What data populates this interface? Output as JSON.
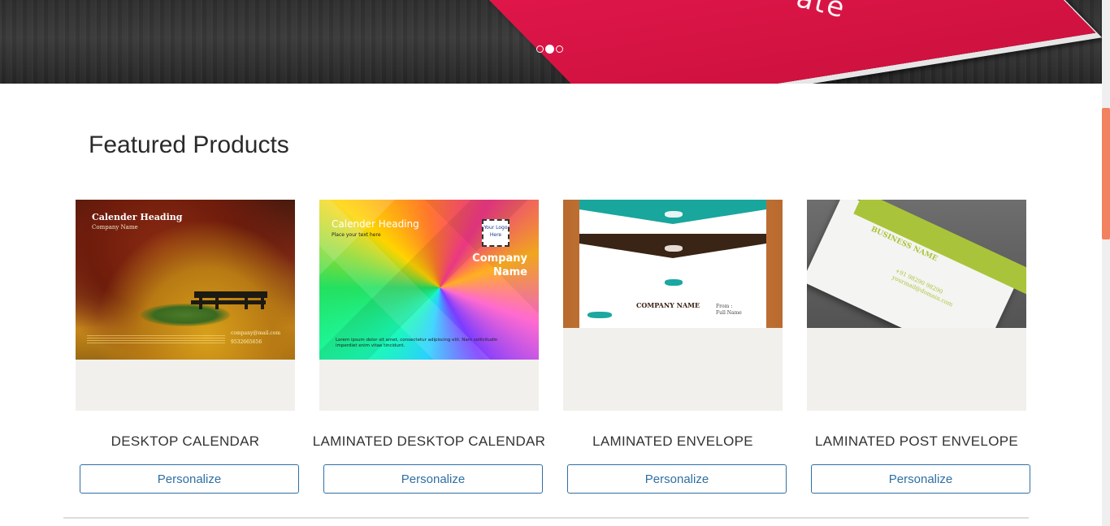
{
  "hero": {
    "slide_text": "ate",
    "slides": [
      {
        "active": false
      },
      {
        "active": true
      },
      {
        "active": false
      }
    ]
  },
  "section": {
    "title": "Featured Products"
  },
  "products": [
    {
      "name": "DESKTOP CALENDAR",
      "button": "Personalize",
      "image": {
        "heading": "Calender Heading",
        "sub": "Company Name",
        "email": "company@mail.com",
        "phone": "9532665656"
      }
    },
    {
      "name": "LAMINATED DESKTOP CALENDAR",
      "button": "Personalize",
      "image": {
        "heading": "Calender Heading",
        "sub": "Place your text here",
        "logo": "Your Logo Here",
        "company1": "Company",
        "company2": "Name",
        "lorem": "Lorem ipsum dolor sit amet, consectetur adipiscing elit. Nam sollicitudin imperdiet enim vitae tincidunt."
      }
    },
    {
      "name": "LAMINATED ENVELOPE",
      "button": "Personalize",
      "image": {
        "company": "COMPANY NAME",
        "from": "From :",
        "full_name": "Full Name"
      }
    },
    {
      "name": "LAMINATED POST ENVELOPE",
      "button": "Personalize",
      "image": {
        "business": "BUSINESS NAME",
        "phone": "+91 98290 98290",
        "email": "yourmail@domain.com"
      }
    }
  ],
  "colors": {
    "accent": "#2f6fa3",
    "scroll_thumb": "#f2825f",
    "card_bg": "#f2f0ec",
    "pink": "#d8144a"
  }
}
